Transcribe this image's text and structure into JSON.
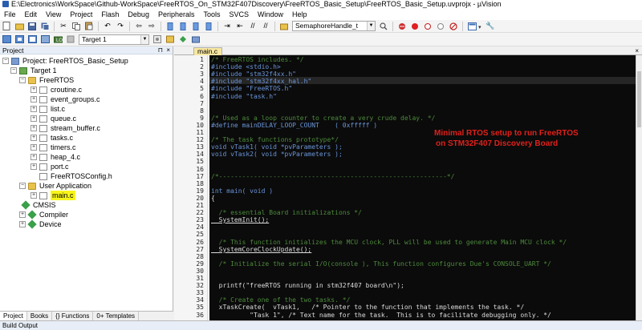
{
  "window": {
    "title": "E:\\Electronics\\WorkSpace\\Github-WorkSpace\\FreeRTOS_On_STM32F407Discovery\\FreeRTOS_Basic_Setup\\FreeRTOS_Basic_Setup.uvprojx - µVision"
  },
  "menu": [
    "File",
    "Edit",
    "View",
    "Project",
    "Flash",
    "Debug",
    "Peripherals",
    "Tools",
    "SVCS",
    "Window",
    "Help"
  ],
  "toolbar": {
    "search_combo": "SemaphoreHandle_t",
    "target_combo": "Target 1",
    "icons": [
      "new-file-icon",
      "open-icon",
      "save-icon",
      "save-all-icon",
      "cut-icon",
      "copy-icon",
      "paste-icon",
      "undo-icon",
      "redo-icon",
      "back-icon",
      "forward-icon",
      "bookmark-icon",
      "indent-icon",
      "unindent-icon",
      "comment-icon",
      "uncomment-icon",
      "find-icon",
      "debug-icon",
      "breakpoint-icon",
      "stop-icon",
      "view-icon",
      "wrench-icon"
    ]
  },
  "project_panel": {
    "header": "Project",
    "tree": {
      "project": "Project: FreeRTOS_Basic_Setup",
      "target": "Target 1",
      "freertos_group": "FreeRTOS",
      "files": [
        "croutine.c",
        "event_groups.c",
        "list.c",
        "queue.c",
        "stream_buffer.c",
        "tasks.c",
        "timers.c",
        "heap_4.c",
        "port.c",
        "FreeRTOSConfig.h"
      ],
      "user_group": "User Application",
      "main_file": "main.c",
      "cmsis": "CMSIS",
      "compiler": "Compiler",
      "device": "Device"
    },
    "tabs": [
      "Project",
      "Books",
      "{} Functions",
      "0+ Templates"
    ]
  },
  "editor": {
    "tab": "main.c",
    "annotation_line1": "Minimal RTOS setup to run FreeRTOS",
    "annotation_line2": "on STM32F407 Discovery Board",
    "lines": [
      {
        "n": "1",
        "t": "/* FreeRTOS includes. */",
        "k": "comment"
      },
      {
        "n": "2",
        "t": "#include <stdio.h>",
        "k": "pre"
      },
      {
        "n": "3",
        "t": "#include \"stm32f4xx.h\"",
        "k": "pre"
      },
      {
        "n": "4",
        "t": "#include \"stm32f4xx_hal.h\"",
        "k": "pre"
      },
      {
        "n": "5",
        "t": "#include \"FreeRTOS.h\"",
        "k": "pre"
      },
      {
        "n": "6",
        "t": "#include \"task.h\"",
        "k": "pre"
      },
      {
        "n": "7",
        "t": "",
        "k": "plain"
      },
      {
        "n": "8",
        "t": "",
        "k": "plain"
      },
      {
        "n": "9",
        "t": "/* Used as a loop counter to create a very crude delay. */",
        "k": "comment"
      },
      {
        "n": "10",
        "t": "#define mainDELAY_LOOP_COUNT    ( 0xfffff )",
        "k": "pre"
      },
      {
        "n": "11",
        "t": "",
        "k": "plain"
      },
      {
        "n": "12",
        "t": "/* The task functions prototype*/",
        "k": "comment"
      },
      {
        "n": "13",
        "t": "void vTask1( void *pvParameters );",
        "k": "kw"
      },
      {
        "n": "14",
        "t": "void vTask2( void *pvParameters );",
        "k": "kw"
      },
      {
        "n": "15",
        "t": "",
        "k": "plain"
      },
      {
        "n": "16",
        "t": "",
        "k": "plain"
      },
      {
        "n": "17",
        "t": "/*-----------------------------------------------------------*/",
        "k": "comment"
      },
      {
        "n": "18",
        "t": "",
        "k": "plain"
      },
      {
        "n": "19",
        "t": "int main( void )",
        "k": "kw"
      },
      {
        "n": "20",
        "t": "{",
        "k": "brace"
      },
      {
        "n": "21",
        "t": "",
        "k": "plain"
      },
      {
        "n": "22",
        "t": "  /* essential Board initializations */",
        "k": "comment"
      },
      {
        "n": "23",
        "t": "  SystemInit();",
        "k": "fnc"
      },
      {
        "n": "24",
        "t": "",
        "k": "plain"
      },
      {
        "n": "25",
        "t": "",
        "k": "plain"
      },
      {
        "n": "26",
        "t": "  /* This function initializes the MCU clock, PLL will be used to generate Main MCU clock */",
        "k": "comment"
      },
      {
        "n": "27",
        "t": "  SystemCoreClockUpdate();",
        "k": "fnc"
      },
      {
        "n": "28",
        "t": "",
        "k": "plain"
      },
      {
        "n": "29",
        "t": "  /* Initialize the serial I/O(console ), This function configures Due's CONSOLE_UART */",
        "k": "comment"
      },
      {
        "n": "30",
        "t": "",
        "k": "plain"
      },
      {
        "n": "31",
        "t": "",
        "k": "plain"
      },
      {
        "n": "32",
        "t": "  printf(\"freeRTOS running in stm32f407 board\\n\");",
        "k": "plain"
      },
      {
        "n": "33",
        "t": "",
        "k": "plain"
      },
      {
        "n": "34",
        "t": "  /* Create one of the two tasks. */",
        "k": "comment"
      },
      {
        "n": "35",
        "t": "  xTaskCreate(  vTask1,   /* Pointer to the function that implements the task. */",
        "k": "plain"
      },
      {
        "n": "36",
        "t": "          \"Task 1\", /* Text name for the task.  This is to facilitate debugging only. */",
        "k": "plain"
      }
    ]
  },
  "build_output": {
    "title": "Build Output"
  }
}
